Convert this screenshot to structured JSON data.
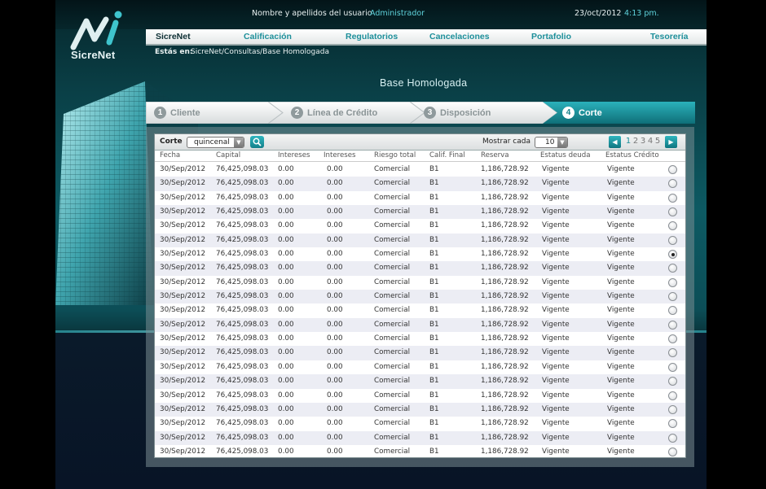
{
  "app": {
    "logo_text": "SicreNet"
  },
  "header": {
    "user_label": "Nombre y apellidos del usuario",
    "user_name": "Administrador",
    "date": "23/oct/2012",
    "time": "4:13 pm."
  },
  "nav": {
    "items": [
      "SicreNet",
      "Calificación",
      "Regulatorios",
      "Cancelaciones",
      "Portafolio",
      "Tesorería"
    ]
  },
  "breadcrumb": {
    "label": "Estás en:",
    "path": "SicreNet/Consultas/Base Homologada"
  },
  "page_title": "Base Homologada",
  "steps": [
    {
      "num": "1",
      "label": "Cliente"
    },
    {
      "num": "2",
      "label": "Línea de Crédito"
    },
    {
      "num": "3",
      "label": "Disposición"
    },
    {
      "num": "4",
      "label": "Corte",
      "active": true
    }
  ],
  "toolbar": {
    "corte_label": "Corte",
    "corte_value": "quincenal",
    "show_label": "Mostrar cada",
    "show_value": "10",
    "pages": [
      "1",
      "2",
      "3",
      "4",
      "5"
    ],
    "current_page": "1"
  },
  "table": {
    "columns": [
      "Fecha",
      "Capital",
      "Intereses",
      "Intereses",
      "Riesgo total",
      "Calif. Final",
      "Reserva",
      "Estatus deuda",
      "Estatus Crédito"
    ],
    "row": [
      "30/Sep/2012",
      "76,425,098.03",
      "0.00",
      "0.00",
      "Comercial",
      "B1",
      "1,186,728.92",
      "Vigente",
      "Vigente"
    ],
    "row_count": 21,
    "selected_row": 7
  },
  "colors": {
    "accent": "#1d8f9a",
    "highlight": "#5fd3dc"
  }
}
